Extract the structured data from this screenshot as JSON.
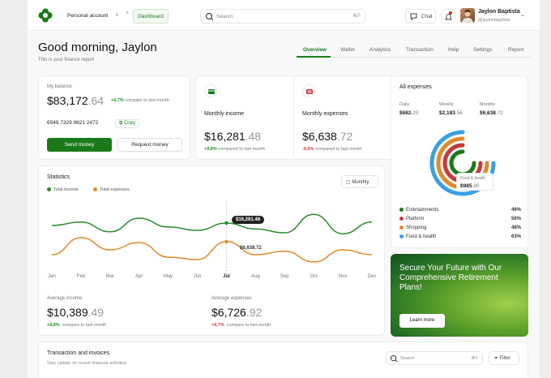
{
  "header": {
    "account": "Personal account",
    "dashboard": "Dashboard",
    "search_placeholder": "Search",
    "search_shortcut": "⌘F",
    "chat": "Chat",
    "user_name": "Jaylon Baptista",
    "user_handle": "@jaylonbaptista"
  },
  "page": {
    "greeting": "Good morning, Jaylon",
    "subtitle": "This is your finance report"
  },
  "tabs": [
    "Overview",
    "Wallet",
    "Analytics",
    "Transaction",
    "Help",
    "Settings",
    "Report"
  ],
  "balance": {
    "label": "My balance",
    "amount_main": "$83,172",
    "amount_dec": ".64",
    "change": "+6,7%",
    "change_note": "compare to last month",
    "card_number": "6549  7329  9821  2472",
    "copy": "Copy",
    "send": "Send money",
    "request": "Request money"
  },
  "income": {
    "label": "Monthly income",
    "amount_main": "$16,281",
    "amount_dec": ".48",
    "change": "+9,8%",
    "change_note": "compared to last month"
  },
  "expenses": {
    "label": "Monthly expenses",
    "amount_main": "$6,638",
    "amount_dec": ".72",
    "change": "-6,6%",
    "change_note": "compared to last month"
  },
  "all_expenses": {
    "title": "All expenses",
    "daily_label": "Daily",
    "daily_main": "$682",
    "daily_dec": ".20",
    "weekly_label": "Weekly",
    "weekly_main": "$2,183",
    "weekly_dec": ".56",
    "monthly_label": "Monthly",
    "monthly_main": "$6,638",
    "monthly_dec": ".72",
    "tooltip_label": "Food & health",
    "tooltip_main": "$985",
    "tooltip_dec": ".90",
    "categories": [
      {
        "name": "Entertainments",
        "pct": "46%",
        "color": "#1a7a1a"
      },
      {
        "name": "Platform",
        "pct": "56%",
        "color": "#c73a3a"
      },
      {
        "name": "Shopping",
        "pct": "48%",
        "color": "#e08a2e"
      },
      {
        "name": "Food & health",
        "pct": "63%",
        "color": "#3aa0e0"
      }
    ]
  },
  "statistics": {
    "title": "Statistics",
    "legend_income": "Total income",
    "legend_expenses": "Total expenses",
    "period": "Monthly",
    "income_color": "#2a8a2a",
    "expenses_color": "#e08a2e",
    "tooltip_income": "$16,281.48",
    "tooltip_expenses": "$6,638.72",
    "avg_income_label": "Average income",
    "avg_income_main": "$10,389",
    "avg_income_dec": ".49",
    "avg_income_change": "+9,8%",
    "avg_income_note": "compare to last month",
    "avg_expenses_label": "Average expenses",
    "avg_expenses_main": "$6,726",
    "avg_expenses_dec": ".92",
    "avg_expenses_change": "+6,7%",
    "avg_expenses_note": "compare to last month"
  },
  "chart_data": {
    "type": "line",
    "categories": [
      "Jan",
      "Feb",
      "Mar",
      "Apr",
      "May",
      "Jun",
      "Jul",
      "Aug",
      "Sep",
      "Oct",
      "Nov",
      "Dec"
    ],
    "series": [
      {
        "name": "Total income",
        "values": [
          0.55,
          0.62,
          0.42,
          0.7,
          0.52,
          0.45,
          0.6,
          0.48,
          0.4,
          0.78,
          0.38,
          0.62
        ]
      },
      {
        "name": "Total expenses",
        "values": [
          -0.05,
          0.3,
          0.05,
          0.2,
          -0.1,
          -0.15,
          0.22,
          -0.05,
          0.02,
          -0.2,
          0.05,
          -0.05
        ]
      }
    ],
    "highlight_index": 6
  },
  "promo": {
    "text": "Secure Your Future with Our Comprehensive Retirement Plans!",
    "button": "Learn more"
  },
  "transactions": {
    "title": "Transaction and invoices",
    "subtitle": "Stay update on recent financial activities",
    "search_placeholder": "Search",
    "search_shortcut": "⌘F",
    "filter": "Filter"
  }
}
